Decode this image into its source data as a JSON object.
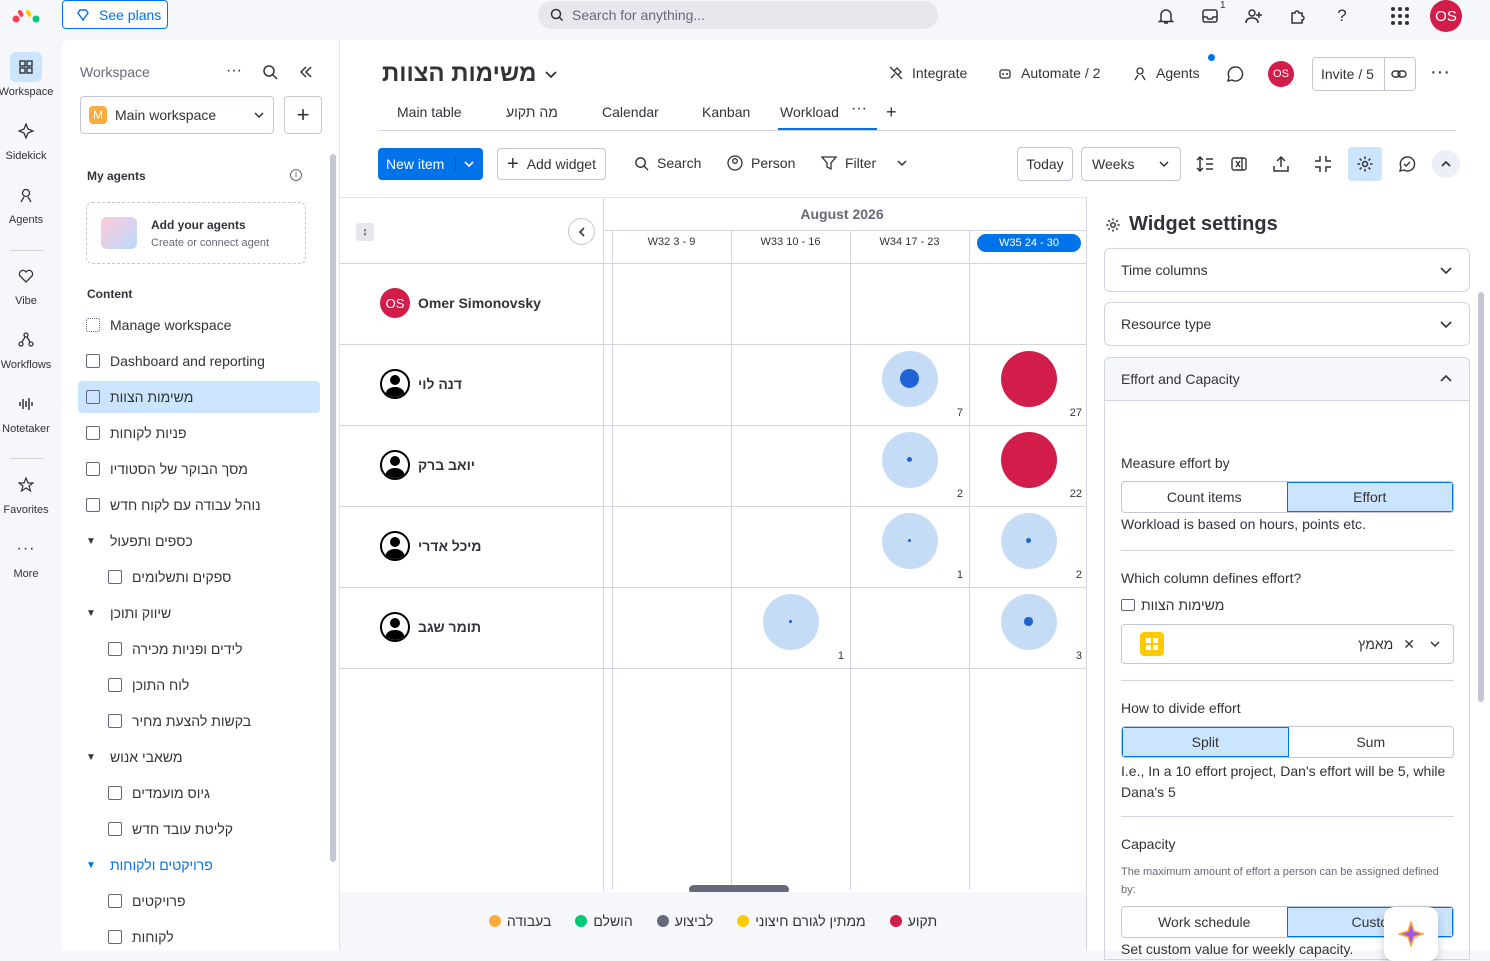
{
  "topbar": {
    "see_plans": "See plans",
    "search_placeholder": "Search for anything...",
    "inbox_badge": "1",
    "user_initials": "OS"
  },
  "rail": [
    {
      "label": "Workspace",
      "icon": "grid-icon"
    },
    {
      "label": "Sidekick",
      "icon": "sparkle-icon"
    },
    {
      "label": "Agents",
      "icon": "agent-icon"
    },
    {
      "label": "Vibe",
      "icon": "heart-icon"
    },
    {
      "label": "Workflows",
      "icon": "workflow-icon"
    },
    {
      "label": "Notetaker",
      "icon": "audio-icon"
    },
    {
      "label": "Favorites",
      "icon": "star-icon"
    },
    {
      "label": "More",
      "icon": "more-icon"
    }
  ],
  "sidebar": {
    "title": "Workspace",
    "workspace_name": "Main workspace",
    "workspace_letter": "M",
    "my_agents": "My agents",
    "add_agents_title": "Add your agents",
    "add_agents_sub": "Create or connect agent",
    "content": "Content",
    "items": [
      "Manage workspace",
      "Dashboard and reporting",
      "משימות הצוות",
      "פניות לקוחות",
      "מסך הבוקר של הסטודיו",
      "נוהל עבודה עם לקוח חדש",
      "כספים ותפעול",
      "ספקים ותשלומים",
      "שיווק ותוכן",
      "לידים ופניות מכירה",
      "לוח התוכן",
      "בקשות להצעת מחיר",
      "משאבי אנוש",
      "גיוס מועמדים",
      "קליטת עובד חדש",
      "פרויקטים ולקוחות",
      "פרויקטים",
      "לקוחות"
    ]
  },
  "board": {
    "title": "משימות הצוות",
    "integrate": "Integrate",
    "automate": "Automate / 2",
    "agents": "Agents",
    "invite": "Invite / 5",
    "tabs": [
      "Main table",
      "מה תקוע",
      "Calendar",
      "Kanban",
      "Workload"
    ],
    "toolbar": {
      "new_item": "New item",
      "add_widget": "Add widget",
      "search": "Search",
      "person": "Person",
      "filter": "Filter",
      "today": "Today",
      "weeks": "Weeks"
    }
  },
  "workload": {
    "month": "August 2026",
    "weeks": [
      "W32 3 - 9",
      "W33 10 - 16",
      "W34 17 - 23",
      "W35 24 - 30"
    ],
    "people": [
      {
        "name": "Omer Simonovsky",
        "initials": "OS"
      },
      {
        "name": "דנה לוי"
      },
      {
        "name": "יואב ברק"
      },
      {
        "name": "מיכל אדרי"
      },
      {
        "name": "תומר שגב"
      }
    ],
    "values": [
      [
        null,
        null,
        null,
        null
      ],
      [
        null,
        null,
        7,
        27
      ],
      [
        null,
        null,
        2,
        22
      ],
      [
        null,
        null,
        1,
        2
      ],
      [
        null,
        1,
        null,
        3
      ]
    ],
    "overload_color": "#d21d4a",
    "normal_color": "#c5dcf7",
    "dot_color": "#1f63d6"
  },
  "legend": [
    {
      "label": "בעבודה",
      "color": "#fdab3d"
    },
    {
      "label": "הושלם",
      "color": "#00c875"
    },
    {
      "label": "לביצוע",
      "color": "#676879"
    },
    {
      "label": "ממתין לגורם חיצוני",
      "color": "#ffcb00"
    },
    {
      "label": "תקוע",
      "color": "#d21d4a"
    }
  ],
  "settings": {
    "title": "Widget settings",
    "time_columns": "Time columns",
    "resource_type": "Resource type",
    "effort_capacity": "Effort and Capacity",
    "measure_by": "Measure effort by",
    "count_items": "Count items",
    "effort": "Effort",
    "measure_desc": "Workload is based on hours, points etc.",
    "which_column": "Which column defines effort?",
    "board_name": "משימות הצוות",
    "column_value": "מאמץ",
    "divide": "How to divide effort",
    "split": "Split",
    "sum": "Sum",
    "divide_desc": "I.e., In a 10 effort project, Dan's effort will be 5, while Dana's 5",
    "capacity": "Capacity",
    "capacity_desc": "The maximum amount of effort a person can be assigned defined by:",
    "work_schedule": "Work schedule",
    "custom": "Custo",
    "custom_desc": "Set custom value for weekly capacity."
  }
}
